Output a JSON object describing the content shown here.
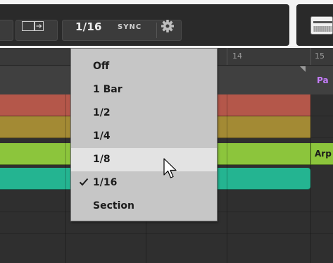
{
  "toolbar": {
    "grid_value": "1/16",
    "sync_label": "SYNC",
    "icons": {
      "follow": "follow-icon",
      "settings": "gear-icon",
      "view": "bars-icon"
    }
  },
  "ruler": {
    "numbers": [
      "14",
      "15"
    ]
  },
  "arranger": {
    "scene_name": "Pa",
    "clip_label": "Arp",
    "colors": {
      "red": "#b4574a",
      "olive": "#a38a34",
      "green": "#8cc53c",
      "teal": "#24b491",
      "scene_text": "#c77dff"
    }
  },
  "grid_menu": {
    "items": [
      {
        "label": "Off",
        "checked": false,
        "hovered": false
      },
      {
        "label": "1 Bar",
        "checked": false,
        "hovered": false
      },
      {
        "label": "1/2",
        "checked": false,
        "hovered": false
      },
      {
        "label": "1/4",
        "checked": false,
        "hovered": false
      },
      {
        "label": "1/8",
        "checked": false,
        "hovered": true
      },
      {
        "label": "1/16",
        "checked": true,
        "hovered": false
      },
      {
        "label": "Section",
        "checked": false,
        "hovered": false
      }
    ]
  }
}
